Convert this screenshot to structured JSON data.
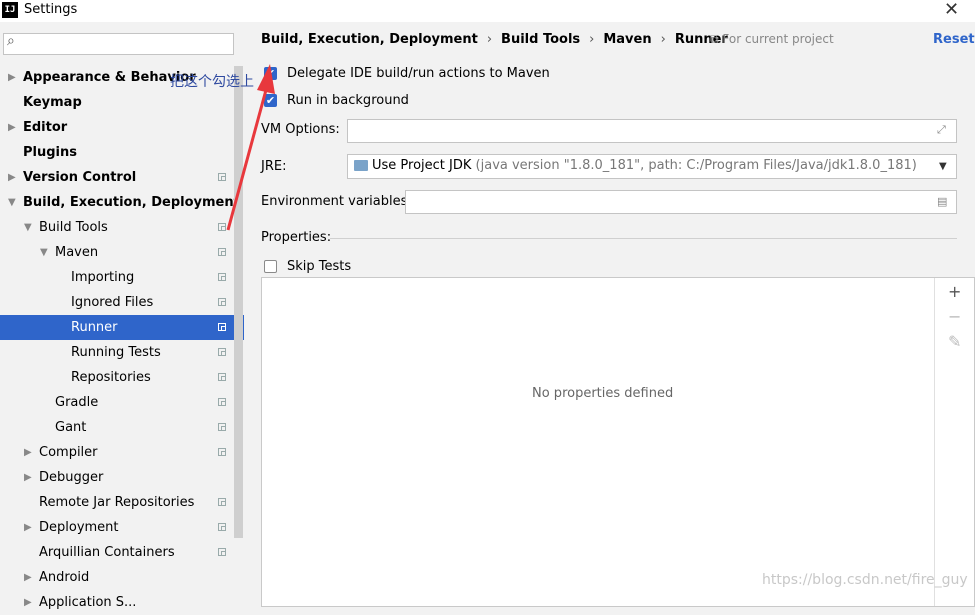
{
  "window": {
    "logo": "IJ",
    "title": "Settings",
    "close_glyph": "✕"
  },
  "sidebar": {
    "search_placeholder": "",
    "items": [
      {
        "label": "Appearance & Behavior",
        "level": 0,
        "bold": true,
        "arrow": "▶",
        "proj": false,
        "selected": false
      },
      {
        "label": "Keymap",
        "level": 0,
        "bold": true,
        "arrow": "",
        "proj": false,
        "selected": false
      },
      {
        "label": "Editor",
        "level": 0,
        "bold": true,
        "arrow": "▶",
        "proj": false,
        "selected": false
      },
      {
        "label": "Plugins",
        "level": 0,
        "bold": true,
        "arrow": "",
        "proj": false,
        "selected": false
      },
      {
        "label": "Version Control",
        "level": 0,
        "bold": true,
        "arrow": "▶",
        "proj": true,
        "selected": false
      },
      {
        "label": "Build, Execution, Deployment",
        "level": 0,
        "bold": true,
        "arrow": "▼",
        "proj": false,
        "selected": false
      },
      {
        "label": "Build Tools",
        "level": 1,
        "bold": false,
        "arrow": "▼",
        "proj": true,
        "selected": false
      },
      {
        "label": "Maven",
        "level": 2,
        "bold": false,
        "arrow": "▼",
        "proj": true,
        "selected": false
      },
      {
        "label": "Importing",
        "level": 3,
        "bold": false,
        "arrow": "",
        "proj": true,
        "selected": false
      },
      {
        "label": "Ignored Files",
        "level": 3,
        "bold": false,
        "arrow": "",
        "proj": true,
        "selected": false
      },
      {
        "label": "Runner",
        "level": 3,
        "bold": false,
        "arrow": "",
        "proj": true,
        "selected": true
      },
      {
        "label": "Running Tests",
        "level": 3,
        "bold": false,
        "arrow": "",
        "proj": true,
        "selected": false
      },
      {
        "label": "Repositories",
        "level": 3,
        "bold": false,
        "arrow": "",
        "proj": true,
        "selected": false
      },
      {
        "label": "Gradle",
        "level": 2,
        "bold": false,
        "arrow": "",
        "proj": true,
        "selected": false
      },
      {
        "label": "Gant",
        "level": 2,
        "bold": false,
        "arrow": "",
        "proj": true,
        "selected": false
      },
      {
        "label": "Compiler",
        "level": 1,
        "bold": false,
        "arrow": "▶",
        "proj": true,
        "selected": false
      },
      {
        "label": "Debugger",
        "level": 1,
        "bold": false,
        "arrow": "▶",
        "proj": false,
        "selected": false
      },
      {
        "label": "Remote Jar Repositories",
        "level": 1,
        "bold": false,
        "arrow": "",
        "proj": true,
        "selected": false
      },
      {
        "label": "Deployment",
        "level": 1,
        "bold": false,
        "arrow": "▶",
        "proj": true,
        "selected": false
      },
      {
        "label": "Arquillian Containers",
        "level": 1,
        "bold": false,
        "arrow": "",
        "proj": true,
        "selected": false
      },
      {
        "label": "Android",
        "level": 1,
        "bold": false,
        "arrow": "▶",
        "proj": false,
        "selected": false
      },
      {
        "label": "Application S...",
        "level": 1,
        "bold": false,
        "arrow": "▶",
        "proj": false,
        "selected": false
      }
    ]
  },
  "main": {
    "breadcrumb": [
      "Build, Execution, Deployment",
      "Build Tools",
      "Maven",
      "Runner"
    ],
    "breadcrumb_sep": "›",
    "for_project": "⧉ For current project",
    "reset_label": "Reset",
    "delegate_label": "Delegate IDE build/run actions to Maven",
    "delegate_checked": true,
    "background_label": "Run in background",
    "background_checked": true,
    "vm_options_label": "VM Options:",
    "vm_options_value": "",
    "jre_label": "JRE:",
    "jre_value": "Use Project JDK",
    "jre_detail": "(java version \"1.8.0_181\", path: C:/Program Files/Java/jdk1.8.0_181)",
    "env_label": "Environment variables:",
    "env_value": "",
    "properties_label": "Properties:",
    "skip_tests_label": "Skip Tests",
    "skip_tests_checked": false,
    "empty_properties": "No properties defined",
    "toolbar": {
      "add": "+",
      "remove": "−",
      "edit": "✎"
    }
  },
  "annotation": {
    "text": "把这个勾选上",
    "color": "#e8383d"
  },
  "watermark": "https://blog.csdn.net/fire_guy"
}
